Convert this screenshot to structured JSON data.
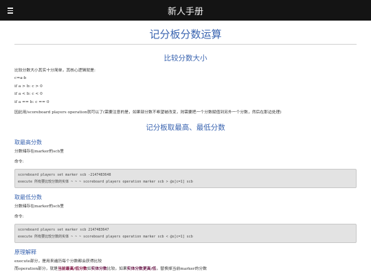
{
  "header": {
    "title": "新人手册",
    "menu_icon": "hamburger-menu-icon"
  },
  "page": {
    "title": "记分板分数运算"
  },
  "compare": {
    "heading": "比较分数大小",
    "intro": "比较分数大小其实十分简单，其核心逻辑就是:",
    "lines": [
      "c=a-b",
      "if a > b: c > 0",
      "if a < b: c < 0",
      "if a == b: c == 0"
    ],
    "note": "因此用/scoreboard players operation就可以了(需要注意的是，如果部分数不希望被改变，则需要把一个分数赋值到另外一个分数，然后在那边处理)"
  },
  "maxmin": {
    "heading": "记分板取最高、最低分数",
    "max": {
      "subheading": "取最高分数",
      "desc": "分数储存在marker的scb里",
      "cmd_label": "命令:",
      "code_line1": "scoreboard players set marker scb -2147483648",
      "code_line2": "execute 所有要比较分数的实体 ~ ~ ~ scoreboard players operation marker scb > @s[c=1] scb"
    },
    "min": {
      "subheading": "取最低分数",
      "desc": "分数储存在marker的scb里",
      "cmd_label": "命令:",
      "code_line1": "scoreboard players set marker scb 2147483647",
      "code_line2": "execute 所有要比较分数的实体 ~ ~ ~ scoreboard players operation marker scb < @s[c=1] scb"
    },
    "explain": {
      "subheading": "原理解释",
      "line1": "execute部分，是用来遍历每个分数都会获得比较",
      "line2_a": "而operation部分，就是",
      "line2_b": "当前最高/低分数",
      "line2_c": "如",
      "line2_d": "实体分数",
      "line2_e": "比较，如果",
      "line2_f": "实体分数更高/低",
      "line2_g": "，替换掉当前marker的分数"
    }
  }
}
